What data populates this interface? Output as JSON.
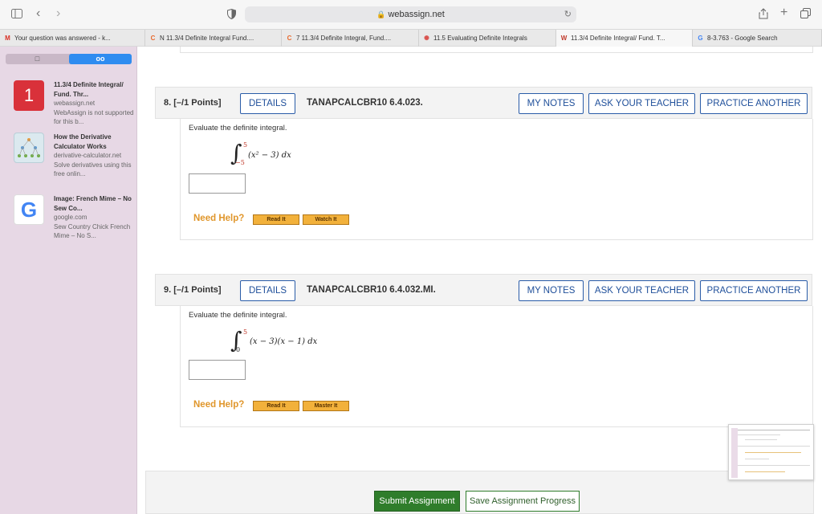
{
  "browser": {
    "url": "webassign.net",
    "tabs": [
      {
        "label": "Your question was answered - k...",
        "icon": "gmail-icon",
        "icon_text": "M",
        "color": "#d93025",
        "width": 181
      },
      {
        "label": "N 11.3/4 Definite Integral Fund....",
        "icon": "cengage-icon",
        "icon_text": "C",
        "color": "#e86a2e",
        "width": 170
      },
      {
        "label": "7 11.3/4 Definite Integral, Fund....",
        "icon": "cengage-icon",
        "icon_text": "C",
        "color": "#e86a2e",
        "width": 171
      },
      {
        "label": "11.5 Evaluating Definite Integrals",
        "icon": "loading-icon",
        "icon_text": "✺",
        "color": "#d9534f",
        "width": 171
      },
      {
        "label": "11.3/4 Definite Integral/ Fund. T...",
        "icon": "webassign-icon",
        "icon_text": "W",
        "color": "#c0392b",
        "width": 170
      },
      {
        "label": "8-3.763 - Google Search",
        "icon": "google-icon",
        "icon_text": "G",
        "color": "#4285f4",
        "width": 161
      }
    ]
  },
  "sidebar": {
    "segment_left": "□",
    "segment_right": "oo",
    "items": [
      {
        "thumb_text": "1",
        "title": "11.3/4 Definite Integral/ Fund. Thr...",
        "domain": "webassign.net",
        "desc": "WebAssign is not supported for this b..."
      },
      {
        "thumb_text": "",
        "title": "How the Derivative Calculator Works",
        "domain": "derivative-calculator.net",
        "desc": "Solve derivatives using this free onlin..."
      },
      {
        "thumb_text": "G",
        "title": "Image: French Mime – No Sew Co...",
        "domain": "google.com",
        "desc": "Sew Country Chick French Mime – No S..."
      }
    ]
  },
  "questions": [
    {
      "number": "8. [–/1 Points]",
      "details": "DETAILS",
      "code": "TANAPCALCBR10 6.4.023.",
      "my_notes": "MY NOTES",
      "ask_teacher": "ASK YOUR TEACHER",
      "practice": "PRACTICE ANOTHER",
      "prompt": "Evaluate the definite integral.",
      "upper": "5",
      "lower": "−5",
      "integrand": "(x² − 3) dx",
      "need_help": "Need Help?",
      "help_btn_1": "Read It",
      "help_btn_2": "Watch It"
    },
    {
      "number": "9. [–/1 Points]",
      "details": "DETAILS",
      "code": "TANAPCALCBR10 6.4.032.MI.",
      "my_notes": "MY NOTES",
      "ask_teacher": "ASK YOUR TEACHER",
      "practice": "PRACTICE ANOTHER",
      "prompt": "Evaluate the definite integral.",
      "upper": "5",
      "lower": "0",
      "integrand": "(x − 3)(x − 1) dx",
      "need_help": "Need Help?",
      "help_btn_1": "Read It",
      "help_btn_2": "Master It"
    }
  ],
  "footer": {
    "submit": "Submit Assignment",
    "save": "Save Assignment Progress"
  }
}
